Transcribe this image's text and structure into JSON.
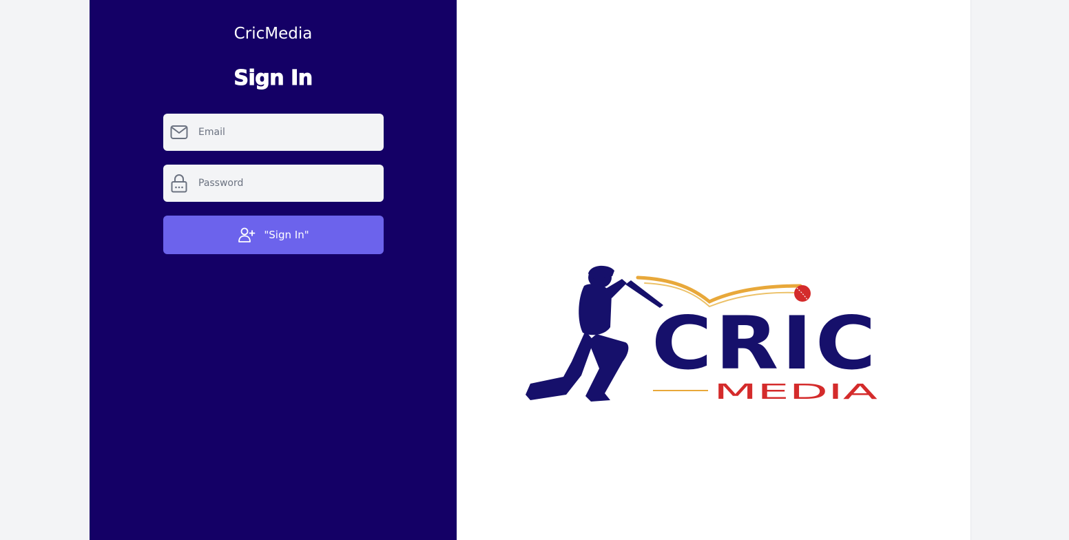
{
  "left": {
    "app_title": "CricMedia",
    "heading": "Sign In",
    "email": {
      "placeholder": "Email",
      "value": ""
    },
    "password": {
      "placeholder": "Password",
      "value": ""
    },
    "submit_label": "\"Sign In\""
  },
  "logo": {
    "word_main": "CRIC",
    "word_sub": "MEDIA"
  },
  "colors": {
    "panel_bg": "#140066",
    "button_bg": "#6c63ec",
    "input_bg": "#f3f4f6",
    "logo_navy": "#16106b",
    "logo_red": "#d42b2b",
    "logo_gold": "#e8a83a"
  },
  "icons": {
    "email": "mail-icon",
    "password": "lock-icon",
    "submit": "user-plus-icon",
    "ball": "cricket-ball-icon"
  }
}
